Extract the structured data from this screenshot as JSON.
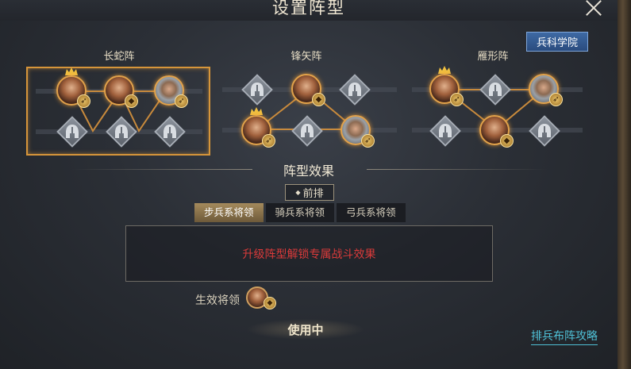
{
  "window": {
    "title": "设置阵型",
    "academy_button": "兵科学院"
  },
  "formations": [
    {
      "name": "长蛇阵",
      "selected": true
    },
    {
      "name": "锋矢阵",
      "selected": false
    },
    {
      "name": "雁形阵",
      "selected": false
    }
  ],
  "effect": {
    "section_title": "阵型效果",
    "row_tag": "前排",
    "tabs": [
      "步兵系将领",
      "骑兵系将领",
      "弓兵系将领"
    ],
    "active_tab": 0,
    "message": "升级阵型解锁专属战斗效果",
    "active_general_label": "生效将领"
  },
  "footer": {
    "status_button": "使用中",
    "guide_link": "排兵布阵攻略"
  },
  "colors": {
    "selected_border": "#d6953a",
    "locked_message": "#d93a3a",
    "guide_link": "#4fc0d6",
    "academy_button": "#2f5590"
  }
}
